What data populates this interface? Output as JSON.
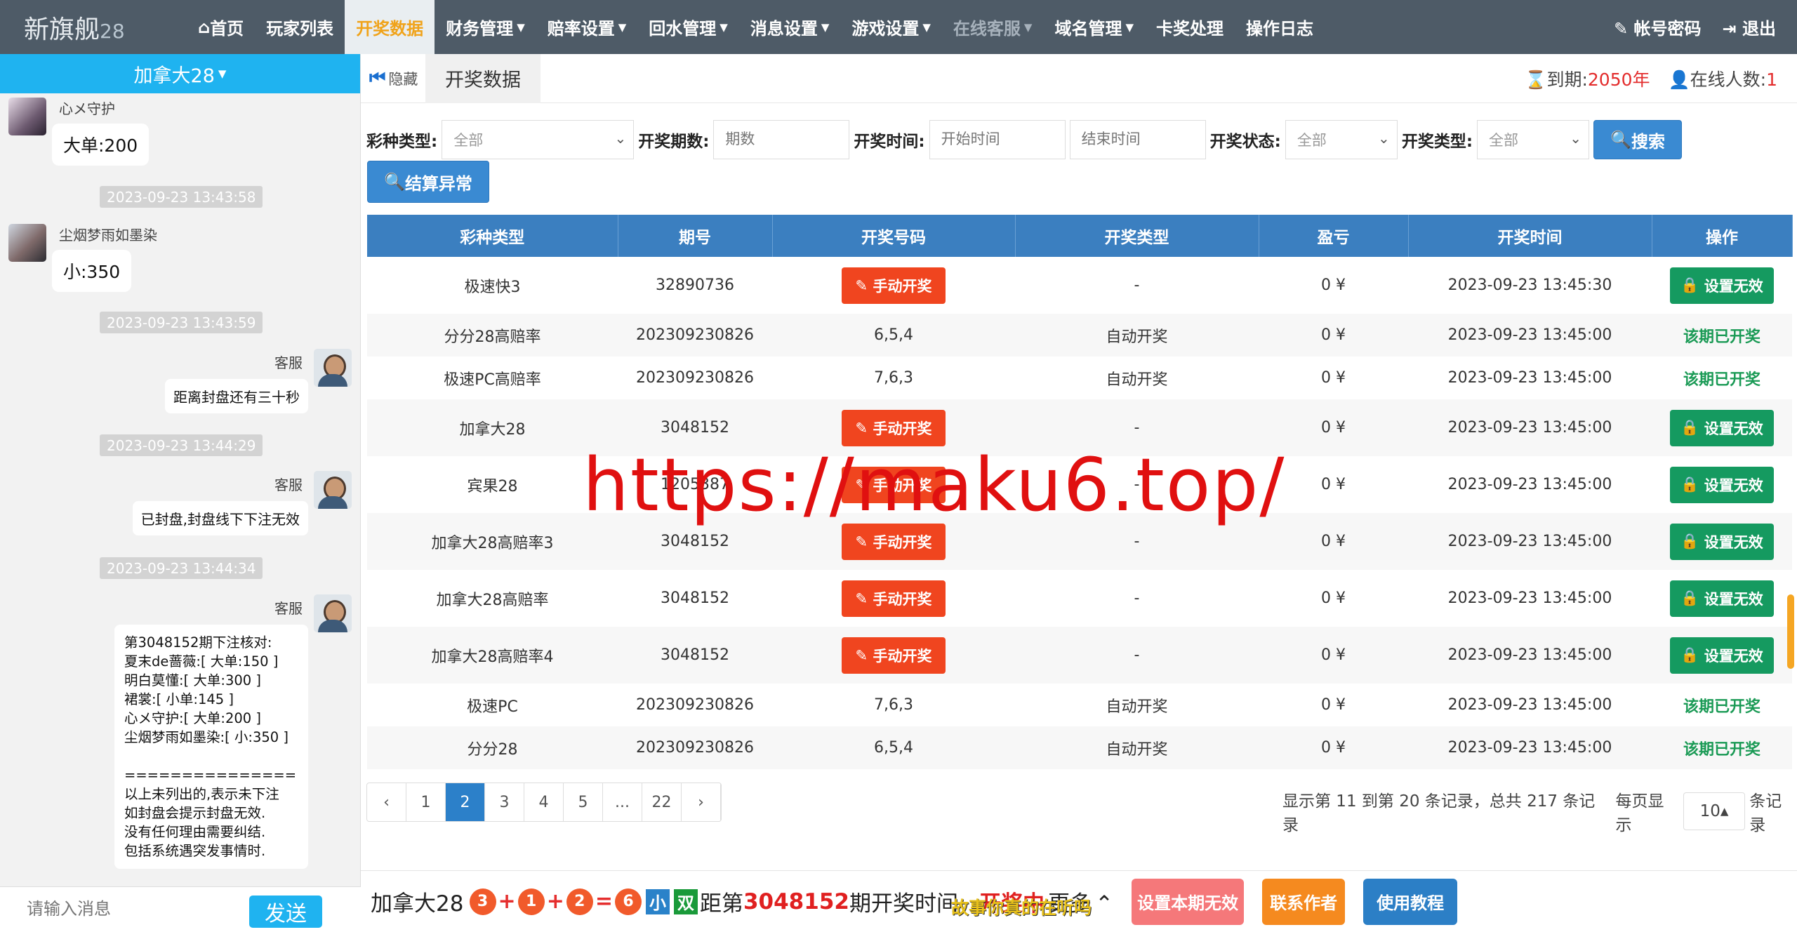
{
  "nav": {
    "logo_main": "新旗舰",
    "logo_sub": "28",
    "items": [
      {
        "label": "首页",
        "icon": "home-icon",
        "caret": false,
        "active": false,
        "muted": false
      },
      {
        "label": "玩家列表",
        "caret": false,
        "active": false,
        "muted": false
      },
      {
        "label": "开奖数据",
        "caret": false,
        "active": true,
        "muted": false
      },
      {
        "label": "财务管理",
        "caret": true,
        "active": false,
        "muted": false
      },
      {
        "label": "赔率设置",
        "caret": true,
        "active": false,
        "muted": false
      },
      {
        "label": "回水管理",
        "caret": true,
        "active": false,
        "muted": false
      },
      {
        "label": "消息设置",
        "caret": true,
        "active": false,
        "muted": false
      },
      {
        "label": "游戏设置",
        "caret": true,
        "active": false,
        "muted": false
      },
      {
        "label": "在线客服",
        "caret": true,
        "active": false,
        "muted": true
      },
      {
        "label": "域名管理",
        "caret": true,
        "active": false,
        "muted": false
      },
      {
        "label": "卡奖处理",
        "caret": false,
        "active": false,
        "muted": false
      },
      {
        "label": "操作日志",
        "caret": false,
        "active": false,
        "muted": false
      }
    ],
    "account": "帐号密码",
    "logout": "退出"
  },
  "chat": {
    "room": "加拿大28",
    "messages": {
      "m1_name": "心メ守护",
      "m1_text": "大单:200",
      "t1": "2023-09-23 13:43:58",
      "m2_name": "尘烟梦雨如墨染",
      "m2_text": "小:350",
      "t2": "2023-09-23 13:43:59",
      "m3_name": "客服",
      "m3_text": "距离封盘还有三十秒",
      "t3": "2023-09-23 13:44:29",
      "m4_name": "客服",
      "m4_text": "已封盘,封盘线下下注无效",
      "t4": "2023-09-23 13:44:34",
      "m5_name": "客服",
      "m5_lines": [
        "第3048152期下注核对:",
        "夏末de蔷薇:[ 大单:150 ]",
        "明白莫懂:[ 大单:300 ]",
        "裙裳:[ 小单:145 ]",
        "心メ守护:[ 大单:200 ]",
        "尘烟梦雨如墨染:[ 小:350 ]",
        "",
        "===============",
        "以上未列出的,表示未下注",
        "如封盘会提示封盘无效.",
        "没有任何理由需要纠结.",
        "包括系统遇突发事情时."
      ]
    },
    "input_placeholder": "请输入消息",
    "send": "发送"
  },
  "tabs": {
    "hide": "隐藏",
    "current": "开奖数据",
    "expire_label": "到期:",
    "expire_value": "2050年",
    "online_label": "在线人数:",
    "online_value": "1"
  },
  "filters": {
    "type_label": "彩种类型:",
    "type_value": "全部",
    "issue_label": "开奖期数:",
    "issue_placeholder": "期数",
    "time_label": "开奖时间:",
    "start_placeholder": "开始时间",
    "end_placeholder": "结束时间",
    "status_label": "开奖状态:",
    "status_value": "全部",
    "kind_label": "开奖类型:",
    "kind_value": "全部",
    "search": "搜索",
    "settle": "结算异常"
  },
  "table": {
    "headers": [
      "彩种类型",
      "期号",
      "开奖号码",
      "开奖类型",
      "盈亏",
      "开奖时间",
      "操作"
    ],
    "manual_btn": "手动开奖",
    "invalid_btn": "设置无效",
    "opened": "该期已开奖",
    "rows": [
      {
        "type": "极速快3",
        "issue": "32890736",
        "numbers": "",
        "kind": "-",
        "profit": "0 ¥",
        "time": "2023-09-23 13:45:30"
      },
      {
        "type": "分分28高赔率",
        "issue": "202309230826",
        "numbers": "6,5,4",
        "kind": "自动开奖",
        "profit": "0 ¥",
        "time": "2023-09-23 13:45:00"
      },
      {
        "type": "极速PC高赔率",
        "issue": "202309230826",
        "numbers": "7,6,3",
        "kind": "自动开奖",
        "profit": "0 ¥",
        "time": "2023-09-23 13:45:00"
      },
      {
        "type": "加拿大28",
        "issue": "3048152",
        "numbers": "",
        "kind": "-",
        "profit": "0 ¥",
        "time": "2023-09-23 13:45:00"
      },
      {
        "type": "宾果28",
        "issue": "1205387",
        "numbers": "",
        "kind": "-",
        "profit": "0 ¥",
        "time": "2023-09-23 13:45:00"
      },
      {
        "type": "加拿大28高赔率3",
        "issue": "3048152",
        "numbers": "",
        "kind": "-",
        "profit": "0 ¥",
        "time": "2023-09-23 13:45:00"
      },
      {
        "type": "加拿大28高赔率",
        "issue": "3048152",
        "numbers": "",
        "kind": "-",
        "profit": "0 ¥",
        "time": "2023-09-23 13:45:00"
      },
      {
        "type": "加拿大28高赔率4",
        "issue": "3048152",
        "numbers": "",
        "kind": "-",
        "profit": "0 ¥",
        "time": "2023-09-23 13:45:00"
      },
      {
        "type": "极速PC",
        "issue": "202309230826",
        "numbers": "7,6,3",
        "kind": "自动开奖",
        "profit": "0 ¥",
        "time": "2023-09-23 13:45:00"
      },
      {
        "type": "分分28",
        "issue": "202309230826",
        "numbers": "6,5,4",
        "kind": "自动开奖",
        "profit": "0 ¥",
        "time": "2023-09-23 13:45:00"
      }
    ]
  },
  "pagination": {
    "pages": [
      "‹",
      "1",
      "2",
      "3",
      "4",
      "5",
      "...",
      "22",
      "›"
    ],
    "active": "2",
    "info": "显示第 11 到第 20 条记录，总共 217 条记录",
    "per_page_label": "每页显示",
    "per_page": "10",
    "per_page_suffix": "条记录"
  },
  "watermark": "https://maku6.top/",
  "bottom": {
    "game": "加拿大28",
    "balls": [
      "3",
      "1",
      "2",
      "6"
    ],
    "tag1": "小",
    "tag2": "双",
    "prefix": "距第",
    "issue": "3048152",
    "suffix": "期开奖时间",
    "status": "开奖中",
    "more": "更多",
    "overlay": "故事你真的在听吗",
    "btn_invalid": "设置本期无效",
    "btn_contact": "联系作者",
    "btn_help": "使用教程"
  },
  "colors": {
    "accent": "#1fb3f0",
    "nav": "#4e5b67",
    "header": "#3b7fc0",
    "danger": "#f0451f",
    "success": "#159a60"
  }
}
